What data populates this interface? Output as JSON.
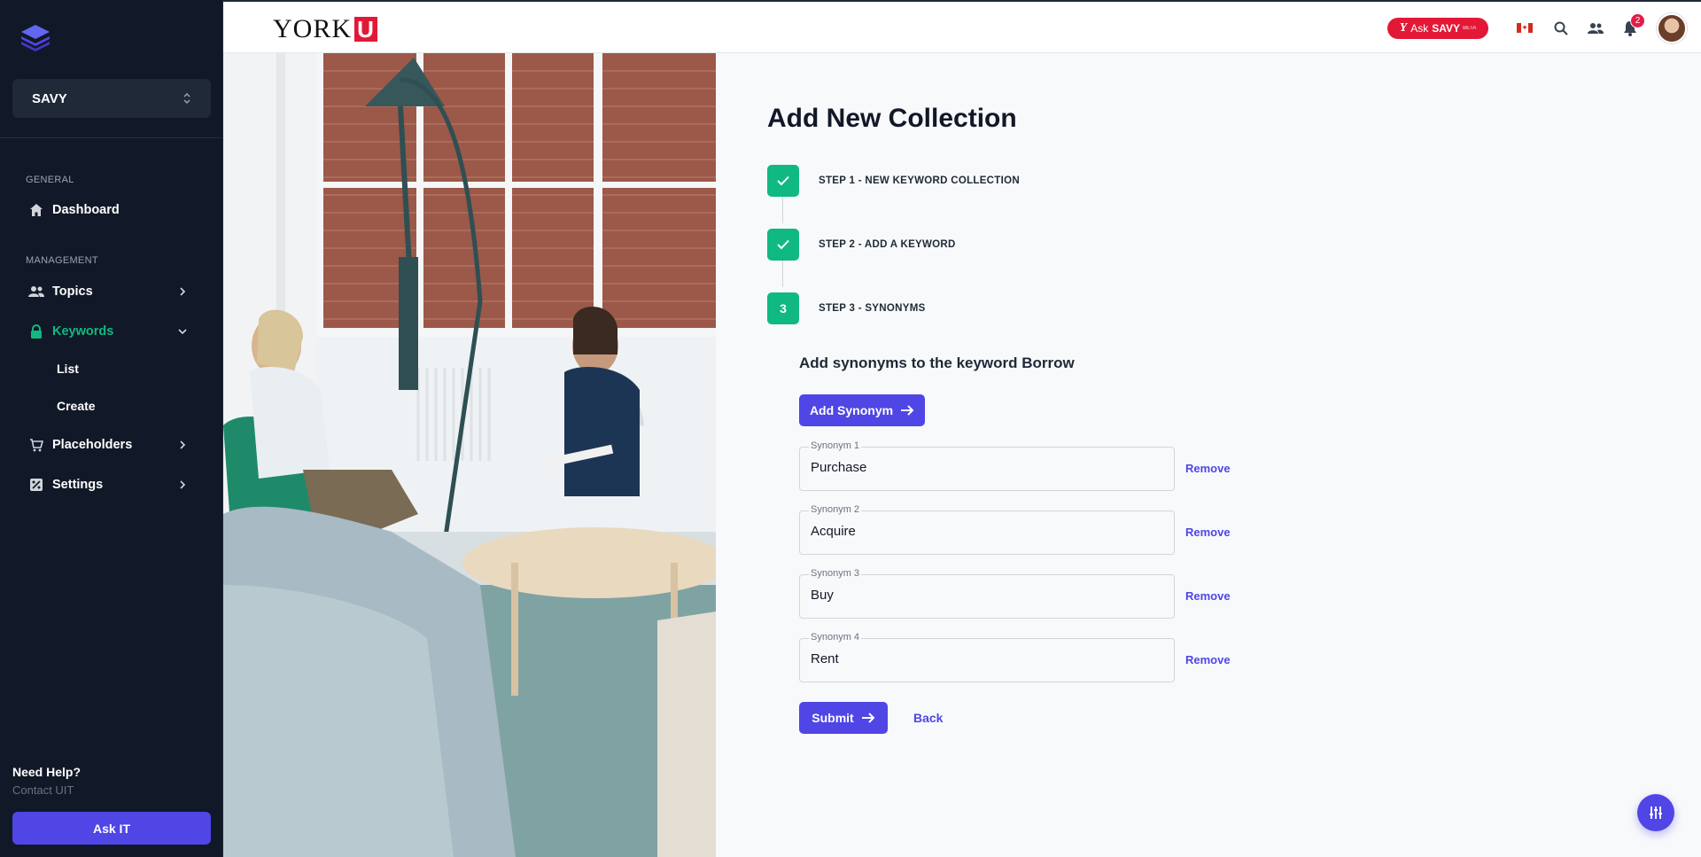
{
  "sidebar": {
    "org_name": "SAVY",
    "section_general": "GENERAL",
    "section_management": "MANAGEMENT",
    "items": {
      "dashboard": "Dashboard",
      "topics": "Topics",
      "keywords": "Keywords",
      "keywords_list": "List",
      "keywords_create": "Create",
      "placeholders": "Placeholders",
      "settings": "Settings"
    },
    "help_title": "Need Help?",
    "help_sub": "Contact UIT",
    "ask_it": "Ask IT",
    "active_color": "#10b981"
  },
  "topbar": {
    "brand_text": "YORK",
    "brand_mark": "U",
    "ask_savy_prefix": "Ask",
    "ask_savy_name": "SAVY",
    "ask_savy_tag": "BETA",
    "notification_count": "2"
  },
  "main": {
    "title": "Add New Collection",
    "steps": [
      {
        "marker": "",
        "label": "STEP 1 - NEW KEYWORD COLLECTION",
        "status": "complete"
      },
      {
        "marker": "",
        "label": "STEP 2 - ADD A KEYWORD",
        "status": "complete"
      },
      {
        "marker": "3",
        "label": "STEP 3 - SYNONYMS",
        "status": "current"
      }
    ],
    "synonyms_heading": "Add synonyms to the keyword Borrow",
    "add_synonym_label": "Add Synonym",
    "synonyms": [
      {
        "label": "Synonym 1",
        "value": "Purchase",
        "remove": "Remove"
      },
      {
        "label": "Synonym 2",
        "value": "Acquire",
        "remove": "Remove"
      },
      {
        "label": "Synonym 3",
        "value": "Buy",
        "remove": "Remove"
      },
      {
        "label": "Synonym 4",
        "value": "Rent",
        "remove": "Remove"
      }
    ],
    "submit_label": "Submit",
    "back_label": "Back"
  },
  "colors": {
    "primary": "#4f46e5",
    "success": "#10b981",
    "brand_red": "#e31837",
    "sidebar_bg": "#111827"
  }
}
